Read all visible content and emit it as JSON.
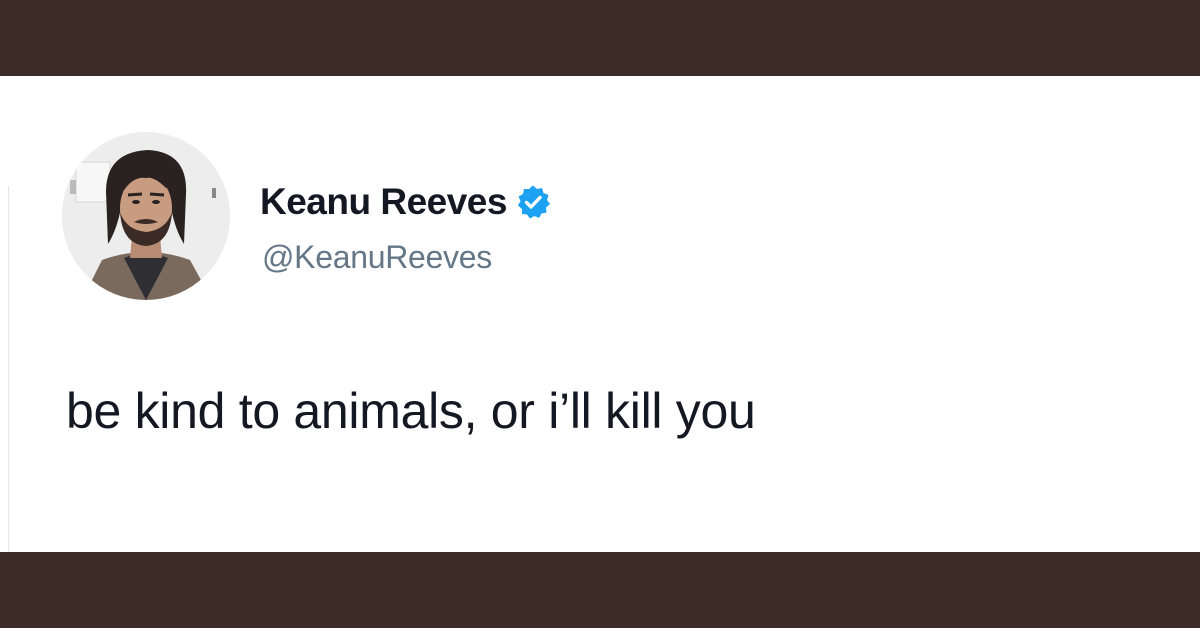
{
  "tweet": {
    "display_name": "Keanu Reeves",
    "handle": "@KeanuReeves",
    "text": "be kind to animals, or i’ll kill you",
    "verified": true
  },
  "colors": {
    "band": "#3e2c28",
    "card": "#ffffff",
    "name": "#141823",
    "handle": "#657786",
    "verified": "#1da1f2"
  },
  "icons": {
    "avatar": "profile-photo",
    "badge": "verified-badge-icon"
  }
}
